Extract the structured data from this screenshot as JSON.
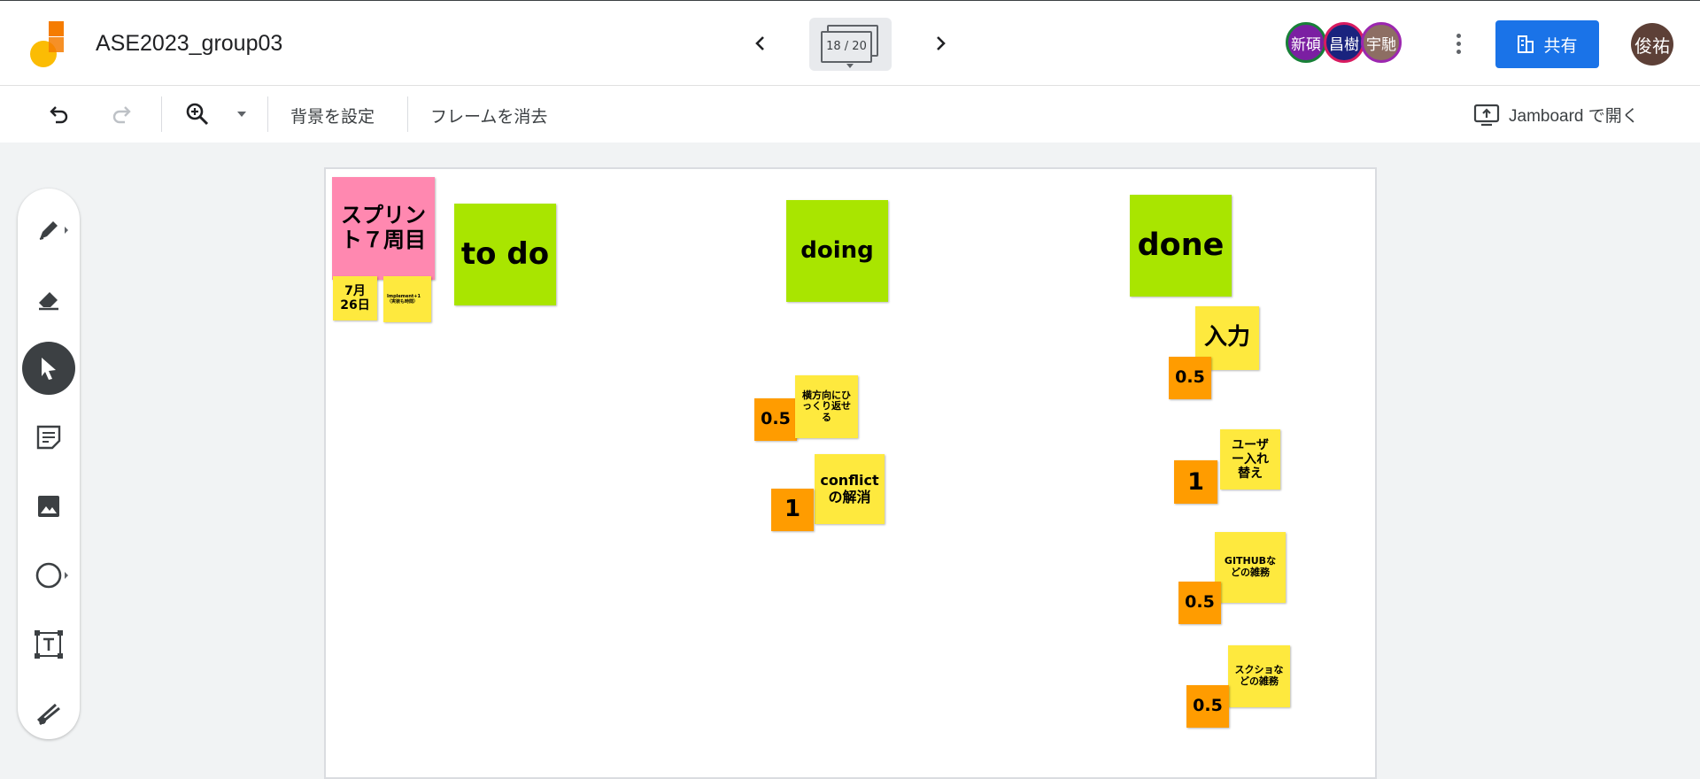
{
  "header": {
    "title": "ASE2023_group03",
    "frame_counter": "18 / 20",
    "collaborators": [
      {
        "initials": "新碩",
        "bg": "#7b1fa2",
        "ring": "#188038"
      },
      {
        "initials": "昌樹",
        "bg": "#1a237e",
        "ring": "#d81b60"
      },
      {
        "initials": "宇馳",
        "bg": "#8d6e63",
        "ring": "#9c27b0"
      }
    ],
    "share_label": "共有",
    "user_initials": "俊祐"
  },
  "toolbar": {
    "set_background": "背景を設定",
    "clear_frame": "フレームを消去",
    "open_in_jamboard": "Jamboard で開く"
  },
  "palette": {
    "tools": [
      "pen-icon",
      "eraser-icon",
      "select-icon",
      "sticky-note-icon",
      "image-icon",
      "circle-icon",
      "text-box-icon",
      "laser-icon"
    ],
    "active": "select-icon"
  },
  "board": {
    "sprint": "スプリント７周目",
    "date": "7月26日",
    "implement_note": "Implement+1（実装も時間）",
    "todo": "to do",
    "doing": "doing",
    "done": "done",
    "doing_items": [
      {
        "points": "0.5",
        "task": "横方向にひっくり返せる"
      },
      {
        "points": "1",
        "task": "conflictの解消"
      }
    ],
    "done_items": [
      {
        "points": "0.5",
        "task": "入力"
      },
      {
        "points": "1",
        "task": "ユーザー入れ替え"
      },
      {
        "points": "0.5",
        "task": "GITHUBなどの雑務"
      },
      {
        "points": "0.5",
        "task": "スクショなどの雑務"
      }
    ]
  },
  "colors": {
    "pink": "#ff88b0",
    "green": "#a9e500",
    "yellow": "#fee93e",
    "orange": "#ff9c00",
    "share_blue": "#1a73e8"
  }
}
